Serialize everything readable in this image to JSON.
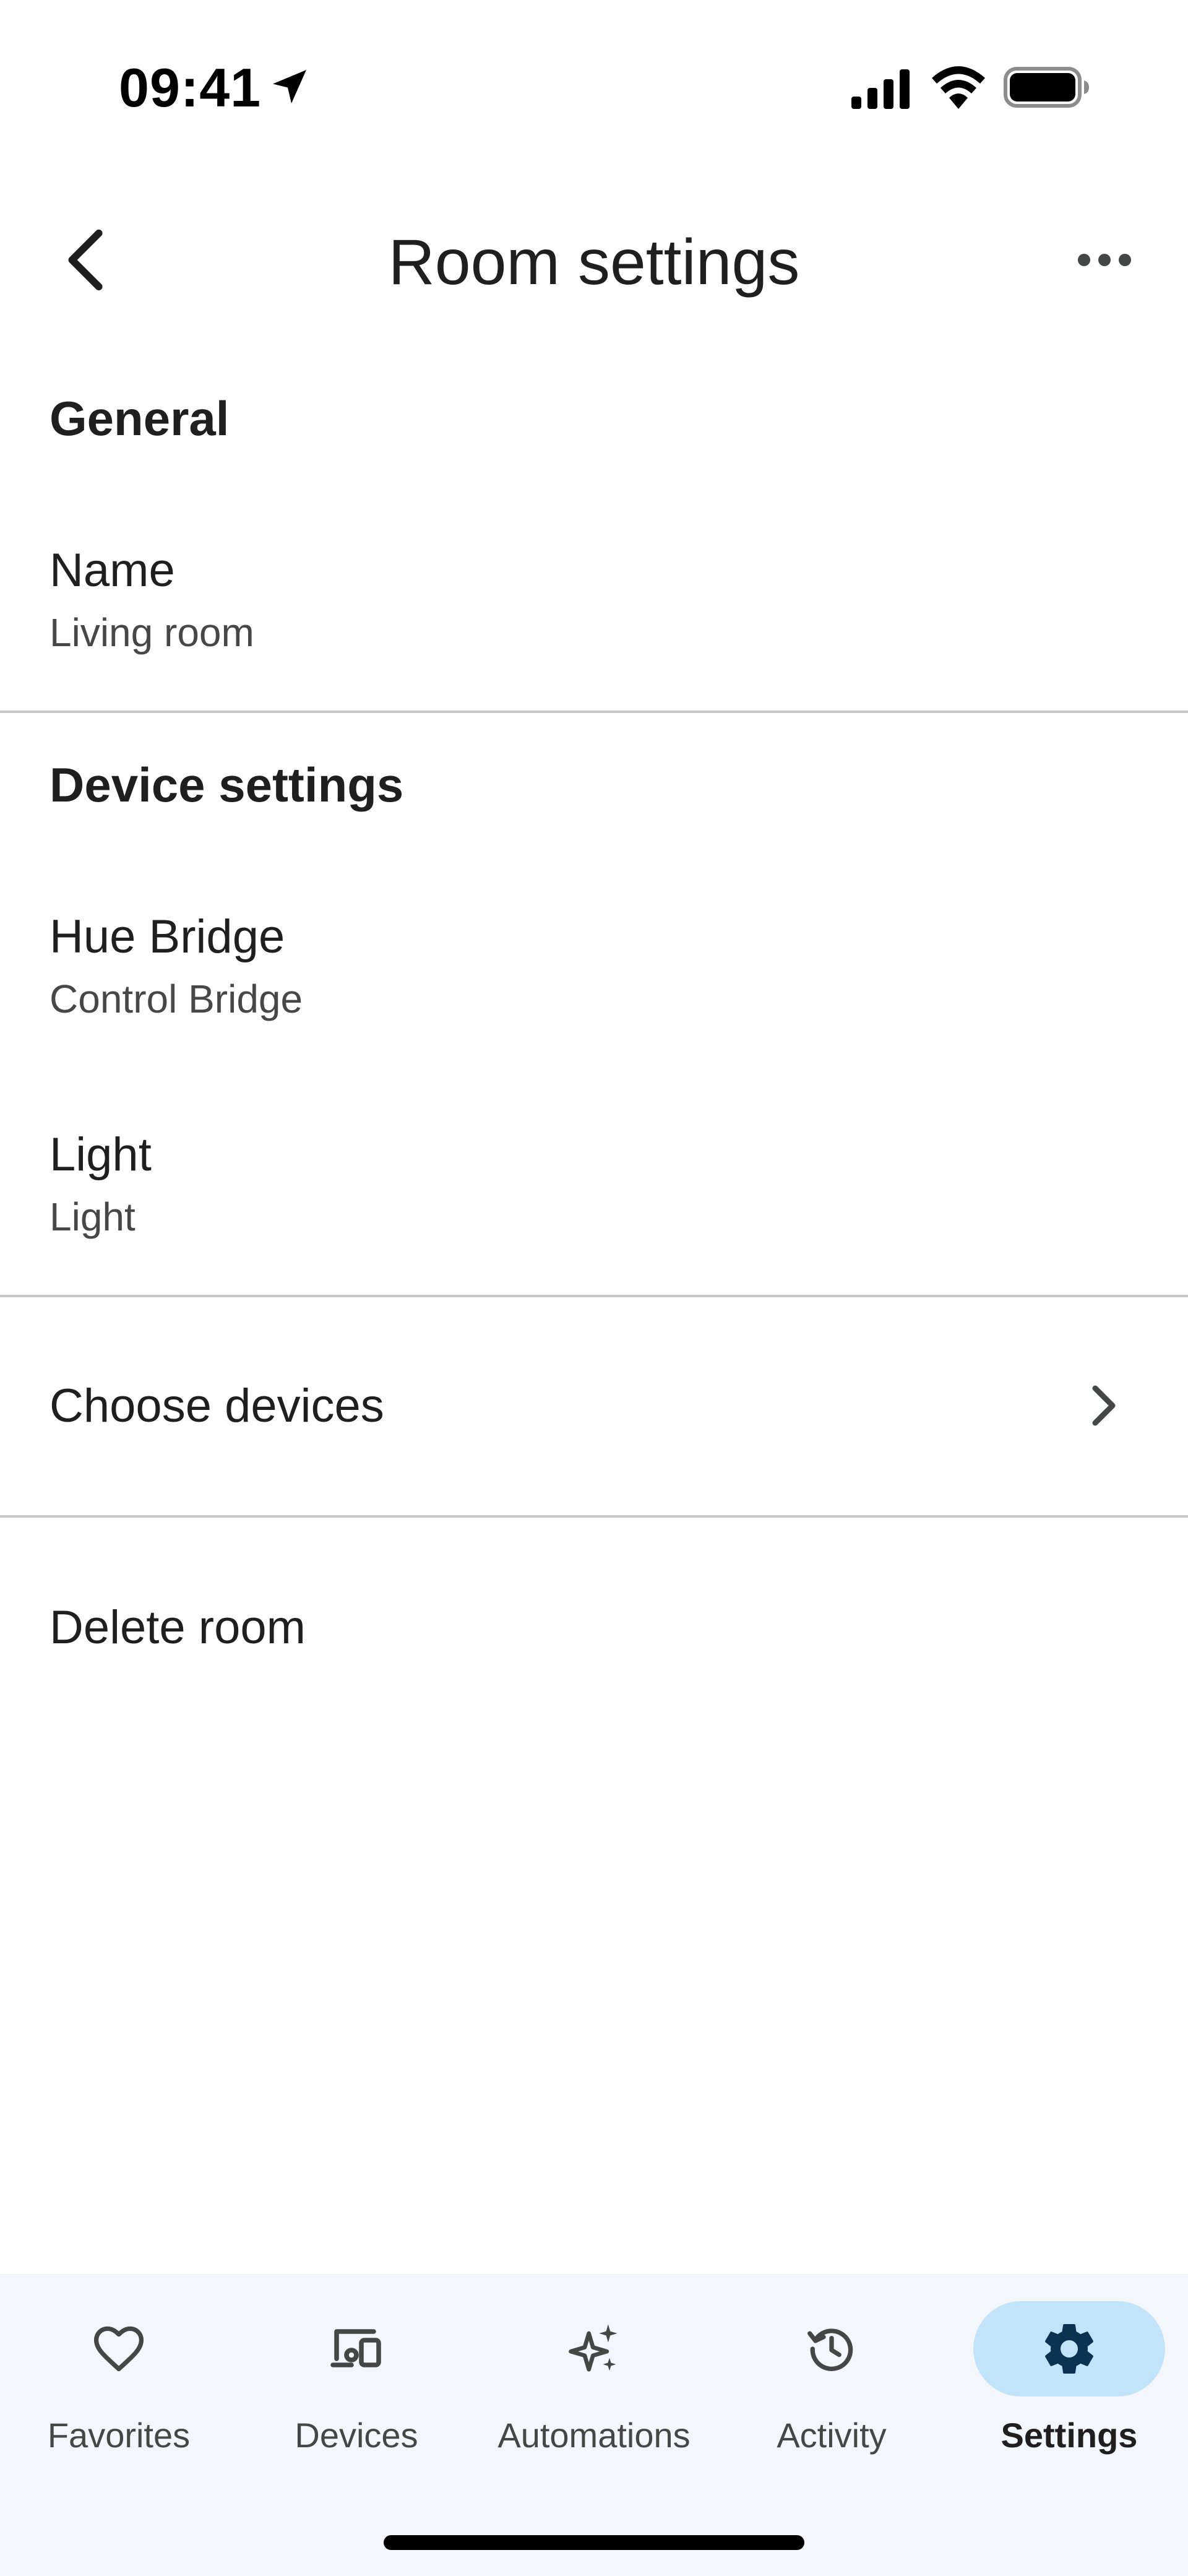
{
  "status_bar": {
    "time": "09:41"
  },
  "header": {
    "title": "Room settings",
    "back_icon": "chevron-left-icon",
    "more_icon": "more-horizontal-icon"
  },
  "sections": {
    "general": {
      "heading": "General",
      "name_row": {
        "title": "Name",
        "value": "Living room"
      }
    },
    "device_settings": {
      "heading": "Device settings",
      "devices": [
        {
          "title": "Hue Bridge",
          "value": "Control Bridge"
        },
        {
          "title": "Light",
          "value": "Light"
        }
      ]
    },
    "choose_devices": {
      "label": "Choose devices"
    },
    "delete_room": {
      "label": "Delete room"
    }
  },
  "bottom_nav": {
    "items": [
      {
        "label": "Favorites",
        "icon": "heart-icon",
        "active": false
      },
      {
        "label": "Devices",
        "icon": "devices-icon",
        "active": false
      },
      {
        "label": "Automations",
        "icon": "sparkle-icon",
        "active": false
      },
      {
        "label": "Activity",
        "icon": "history-icon",
        "active": false
      },
      {
        "label": "Settings",
        "icon": "gear-icon",
        "active": true
      }
    ]
  },
  "colors": {
    "background": "#ffffff",
    "nav_background": "#f3f6fb",
    "active_pill": "#c2e4fb",
    "active_icon": "#0b3250",
    "divider": "#c8c8c8"
  }
}
